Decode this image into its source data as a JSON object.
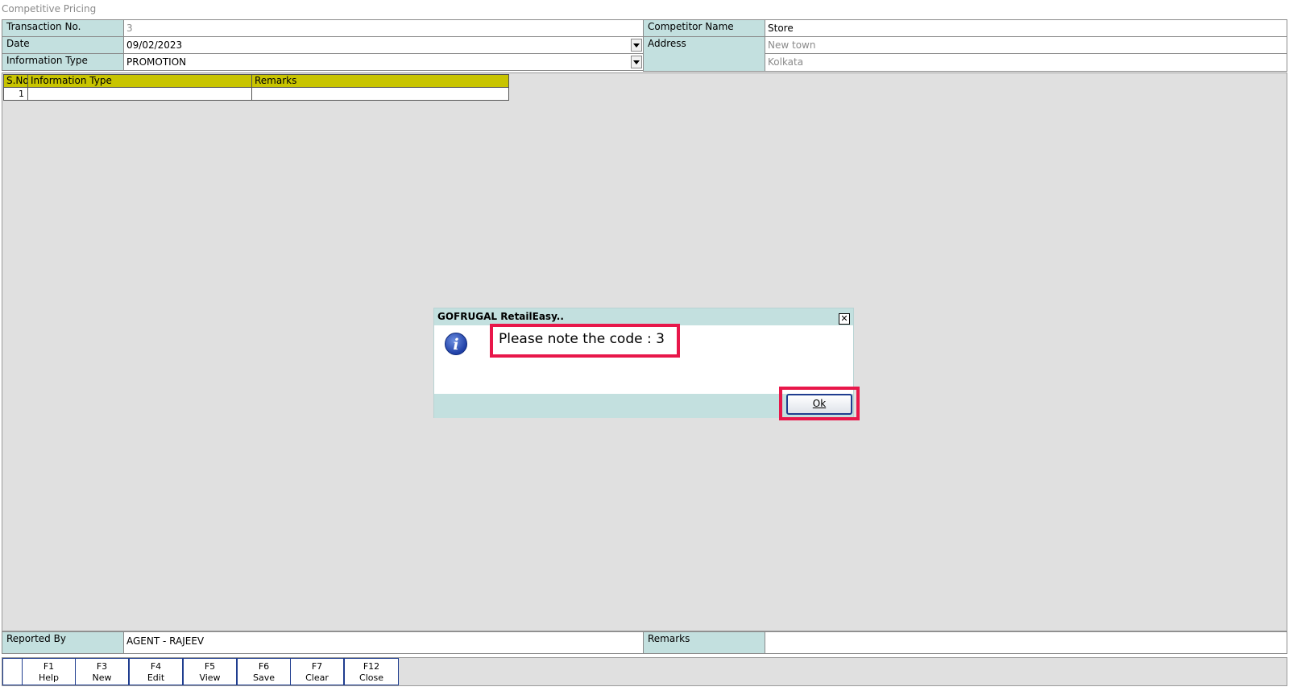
{
  "window": {
    "title": "Competitive Pricing"
  },
  "form": {
    "transaction_no_label": "Transaction No.",
    "transaction_no_value": "3",
    "date_label": "Date",
    "date_value": "09/02/2023",
    "info_type_label": "Information Type",
    "info_type_value": "PROMOTION",
    "competitor_name_label": "Competitor Name",
    "competitor_name_value": "Store",
    "address_label": "Address",
    "address_line1": "New town",
    "address_line2": "Kolkata"
  },
  "grid": {
    "headers": [
      "S.No",
      "Information Type",
      "Remarks"
    ],
    "rows": [
      {
        "sno": "1",
        "info_type": "",
        "remarks": ""
      }
    ]
  },
  "dialog": {
    "title": "GOFRUGAL RetailEasy..",
    "close_glyph": "✕",
    "icon": "info-icon",
    "message": "Please note the code : 3",
    "ok_label": "Ok"
  },
  "footer": {
    "reported_by_label": "Reported By",
    "reported_by_value": "AGENT - RAJEEV",
    "remarks_label": "Remarks",
    "remarks_value": ""
  },
  "fkeys": [
    {
      "key": "F1",
      "label": "Help"
    },
    {
      "key": "F3",
      "label": "New"
    },
    {
      "key": "F4",
      "label": "Edit"
    },
    {
      "key": "F5",
      "label": "View"
    },
    {
      "key": "F6",
      "label": "Save"
    },
    {
      "key": "F7",
      "label": "Clear"
    },
    {
      "key": "F12",
      "label": "Close"
    }
  ],
  "colors": {
    "label_bg": "#c3e0df",
    "grid_header_bg": "#c8c400",
    "highlight": "#e8174a",
    "workarea_bg": "#e0e0e0"
  }
}
